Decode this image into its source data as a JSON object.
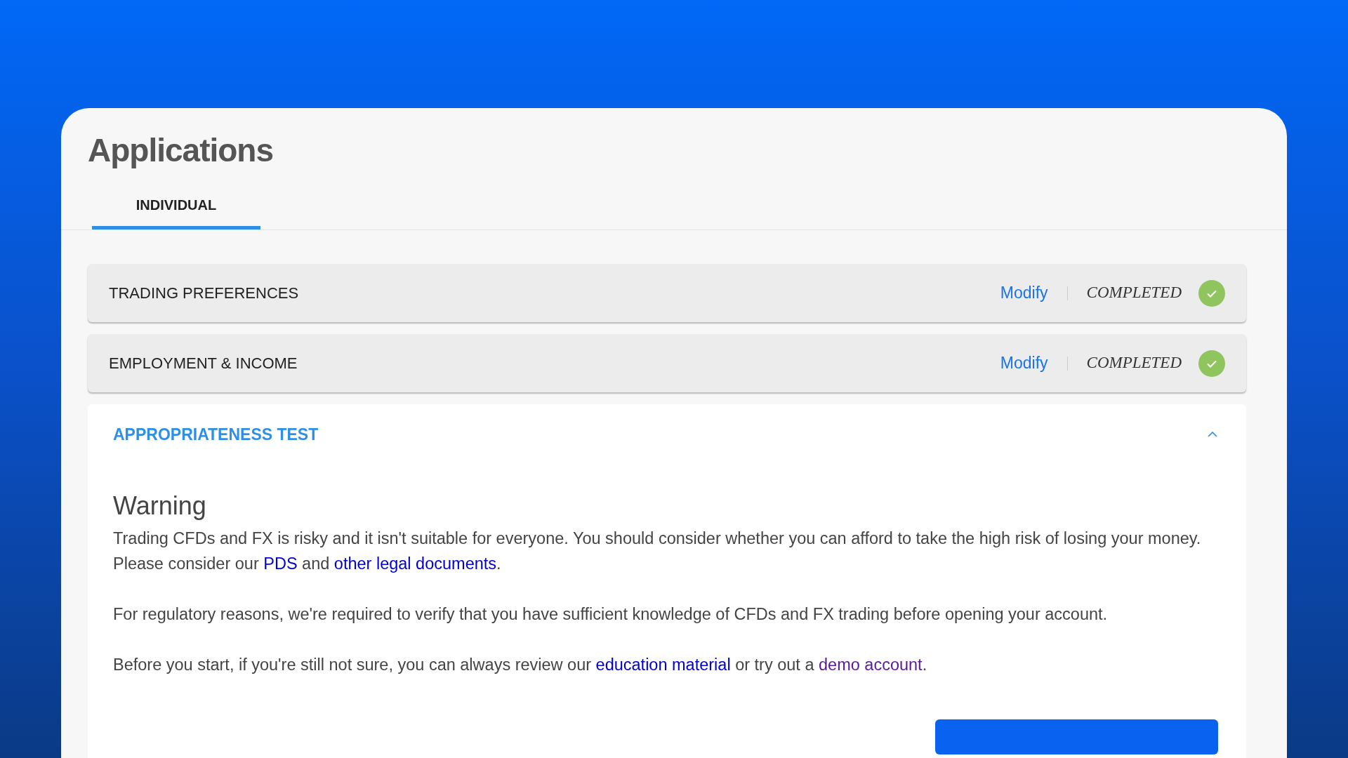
{
  "page": {
    "title": "Applications"
  },
  "tabs": [
    {
      "label": "INDIVIDUAL",
      "selected": true
    }
  ],
  "sections": [
    {
      "title": "TRADING PREFERENCES",
      "action": "Modify",
      "status": "COMPLETED",
      "completed": true,
      "expanded": false
    },
    {
      "title": "EMPLOYMENT & INCOME",
      "action": "Modify",
      "status": "COMPLETED",
      "completed": true,
      "expanded": false
    },
    {
      "title": "APPROPRIATENESS TEST",
      "expanded": true,
      "heading": "Warning",
      "paragraphs": [
        [
          {
            "text": "Trading CFDs and FX is risky and it isn't suitable for everyone. You should consider whether you can afford to take the high risk of losing your money. Please consider our "
          },
          {
            "text": "PDS",
            "link": true,
            "visited": false
          },
          {
            "text": " and "
          },
          {
            "text": "other legal documents",
            "link": true,
            "visited": false
          },
          {
            "text": "."
          }
        ],
        [
          {
            "text": "For regulatory reasons, we're required to verify that you have sufficient knowledge of CFDs and FX trading before opening your account."
          }
        ],
        [
          {
            "text": "Before you start, if you're still not sure, you can always review our "
          },
          {
            "text": "education material",
            "link": true,
            "visited": false
          },
          {
            "text": " or try out a "
          },
          {
            "text": "demo account",
            "link": true,
            "visited": true
          },
          {
            "text": "."
          }
        ]
      ]
    }
  ]
}
